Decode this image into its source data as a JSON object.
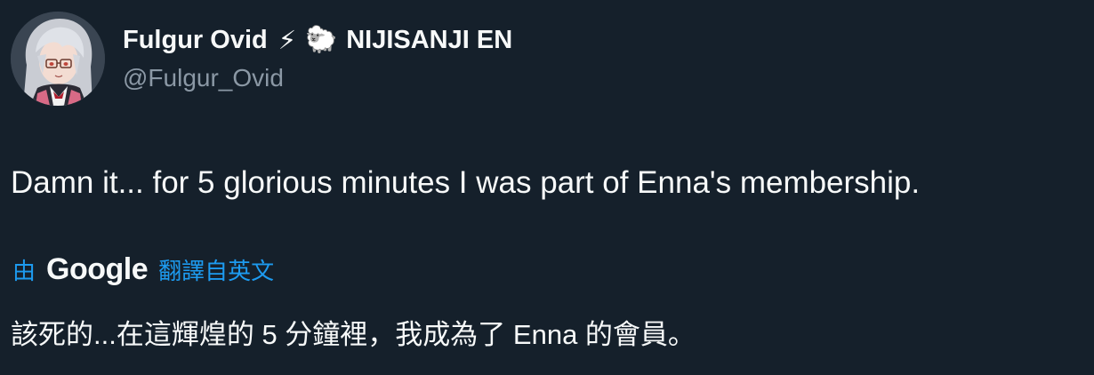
{
  "author": {
    "display_name": "Fulgur Ovid",
    "bolt_emoji": "⚡",
    "sheep_emoji": "🐑",
    "affiliation": "NIJISANJI EN",
    "handle": "@Fulgur_Ovid",
    "avatar_icon": "anime-avatar-icon"
  },
  "tweet": {
    "text": "Damn it... for 5 glorious minutes I was part of Enna's membership."
  },
  "translation": {
    "by_label": "由",
    "provider": "Google",
    "from_label": "翻譯自英文",
    "text": "該死的...在這輝煌的 5 分鐘裡，我成為了 Enna 的會員。"
  },
  "colors": {
    "background": "#15202b",
    "primary_text": "#f7f9f9",
    "secondary_text": "#8b98a5",
    "link": "#1d9bf0"
  }
}
